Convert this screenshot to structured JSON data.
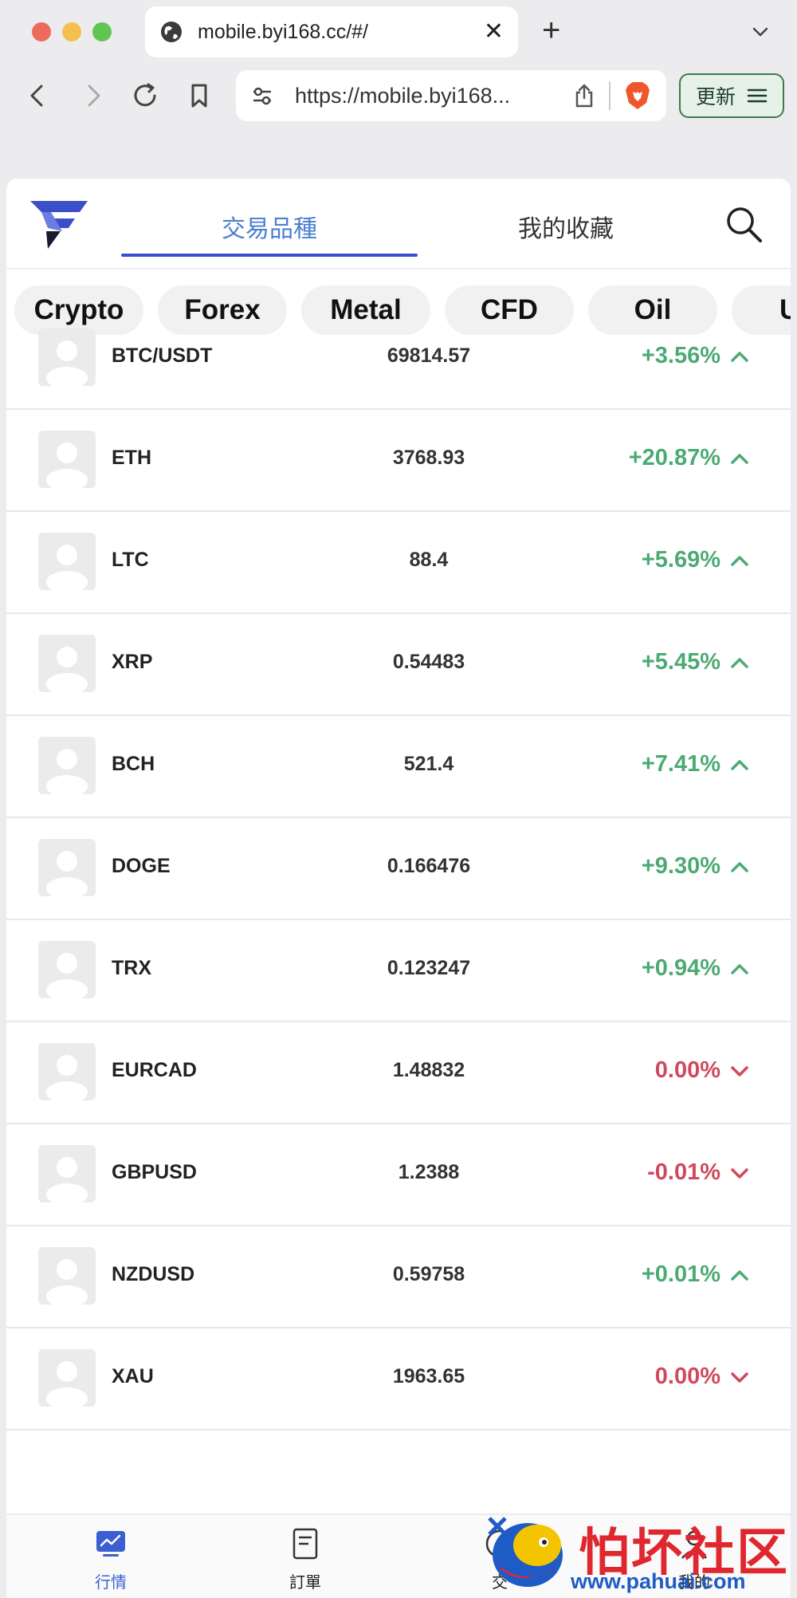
{
  "browser": {
    "tab_title": "mobile.byi168.cc/#/",
    "url": "https://mobile.byi168...",
    "update_label": "更新"
  },
  "app": {
    "tabs": [
      {
        "label": "交易品種",
        "active": true
      },
      {
        "label": "我的收藏",
        "active": false
      }
    ],
    "categories": [
      "Crypto",
      "Forex",
      "Metal",
      "CFD",
      "Oil",
      "U"
    ],
    "accent_color": "#3b4fc8",
    "up_color": "#4caa73",
    "down_color": "#d1485c",
    "rows": [
      {
        "symbol": "BTC/USDT",
        "price": "69814.57",
        "change": "+3.56%",
        "dir": "up"
      },
      {
        "symbol": "ETH",
        "price": "3768.93",
        "change": "+20.87%",
        "dir": "up"
      },
      {
        "symbol": "LTC",
        "price": "88.4",
        "change": "+5.69%",
        "dir": "up"
      },
      {
        "symbol": "XRP",
        "price": "0.54483",
        "change": "+5.45%",
        "dir": "up"
      },
      {
        "symbol": "BCH",
        "price": "521.4",
        "change": "+7.41%",
        "dir": "up"
      },
      {
        "symbol": "DOGE",
        "price": "0.166476",
        "change": "+9.30%",
        "dir": "up"
      },
      {
        "symbol": "TRX",
        "price": "0.123247",
        "change": "+0.94%",
        "dir": "up"
      },
      {
        "symbol": "EURCAD",
        "price": "1.48832",
        "change": "0.00%",
        "dir": "down"
      },
      {
        "symbol": "GBPUSD",
        "price": "1.2388",
        "change": "-0.01%",
        "dir": "down"
      },
      {
        "symbol": "NZDUSD",
        "price": "0.59758",
        "change": "+0.01%",
        "dir": "up"
      },
      {
        "symbol": "XAU",
        "price": "1963.65",
        "change": "0.00%",
        "dir": "down"
      }
    ],
    "bottom_nav": [
      {
        "label": "行情",
        "icon": "chart-monitor-icon",
        "active": true
      },
      {
        "label": "訂單",
        "icon": "document-icon",
        "active": false
      },
      {
        "label": "交",
        "icon": "trade-icon",
        "active": false
      },
      {
        "label": "我的",
        "icon": "user-icon",
        "active": false
      }
    ]
  },
  "watermark": {
    "text": "怕坏社区",
    "url": "www.pahuai.com"
  }
}
